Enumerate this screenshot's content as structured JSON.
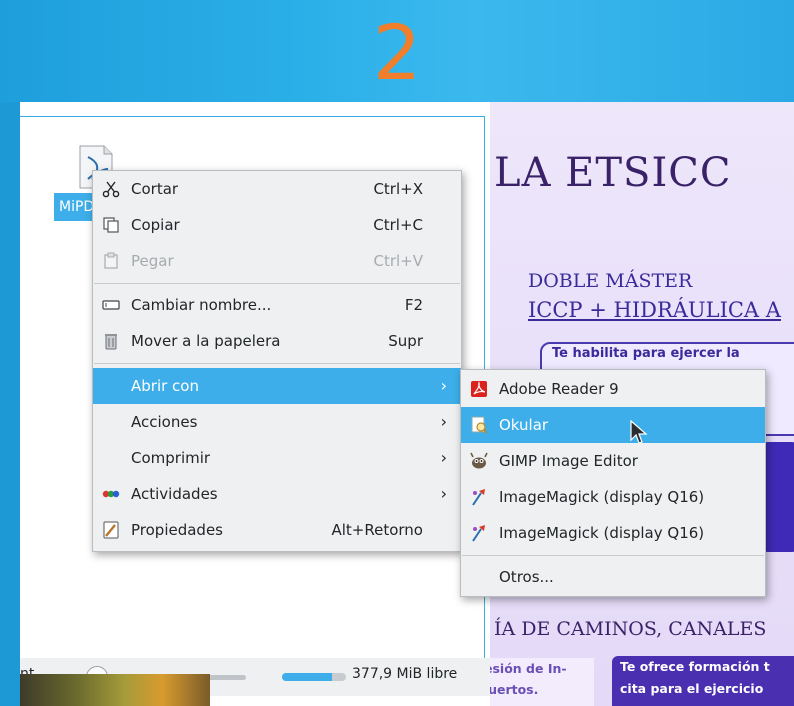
{
  "step_number": "2",
  "file": {
    "label": "MiPDF"
  },
  "context_menu": {
    "cut": {
      "label": "Cortar",
      "shortcut": "Ctrl+X",
      "icon": "scissors-icon"
    },
    "copy": {
      "label": "Copiar",
      "shortcut": "Ctrl+C",
      "icon": "copy-icon"
    },
    "paste": {
      "label": "Pegar",
      "shortcut": "Ctrl+V",
      "icon": "paste-icon",
      "disabled": true
    },
    "rename": {
      "label": "Cambiar nombre...",
      "shortcut": "F2",
      "icon": "rename-icon"
    },
    "trash": {
      "label": "Mover a la papelera",
      "shortcut": "Supr",
      "icon": "trash-icon"
    },
    "open_with": {
      "label": "Abrir con",
      "highlighted": true
    },
    "actions": {
      "label": "Acciones"
    },
    "compress": {
      "label": "Comprimir"
    },
    "activities": {
      "label": "Actividades",
      "icon": "activities-icon"
    },
    "properties": {
      "label": "Propiedades",
      "shortcut": "Alt+Retorno",
      "icon": "properties-icon"
    }
  },
  "submenu": {
    "items": [
      {
        "label": "Adobe Reader 9",
        "icon": "adobe-reader-icon"
      },
      {
        "label": "Okular",
        "icon": "okular-icon",
        "highlighted": true
      },
      {
        "label": "GIMP Image Editor",
        "icon": "gimp-icon"
      },
      {
        "label": "ImageMagick (display Q16)",
        "icon": "imagemagick-icon"
      },
      {
        "label": "ImageMagick (display Q16)",
        "icon": "imagemagick-icon"
      }
    ],
    "others": "Otros..."
  },
  "statusbar": {
    "left_text": "nt...",
    "free_space": "377,9 MiB libre"
  },
  "poster": {
    "title": "LA ETSICC",
    "doble": "DOBLE MÁSTER",
    "iccp": "ICCP + HIDRÁULICA A",
    "habilita": "Te habilita para ejercer la",
    "caminos": "ÍA DE CAMINOS, CANALES",
    "left_tag_1": "esión de In-",
    "left_tag_2": "geniero de Caminos, Canales y Puertos.",
    "right_tag_1": "Te ofrece formación t",
    "right_tag_2": "cita para el ejercicio"
  },
  "colors": {
    "accent": "#3daee9",
    "background": "#1a9bd7",
    "step_number": "#f07e2a"
  }
}
